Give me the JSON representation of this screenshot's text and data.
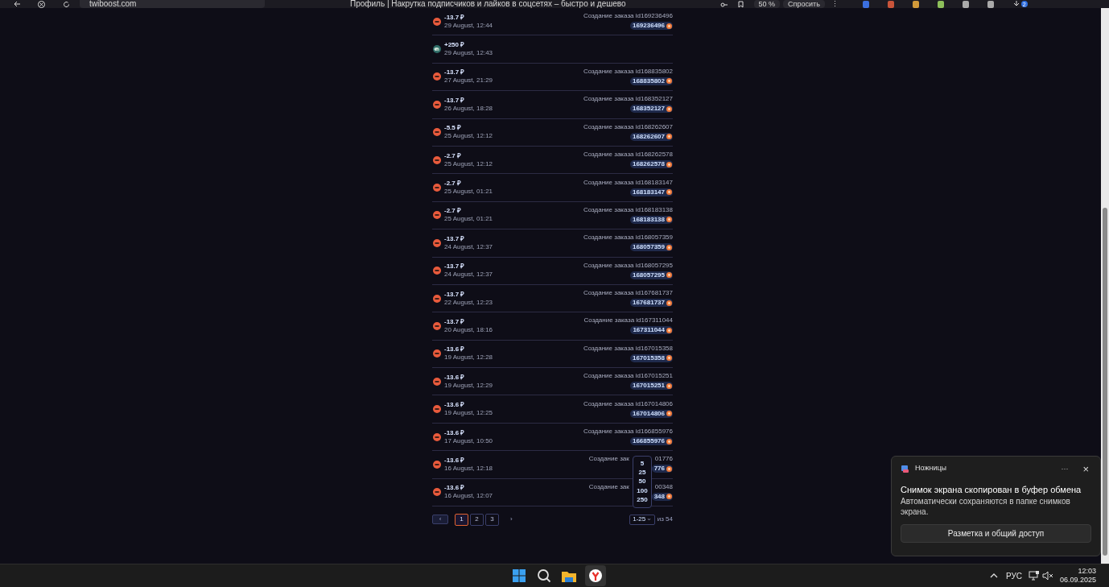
{
  "browser": {
    "url": "twiboost.com",
    "title": "Профиль | Накрутка подписчиков и лайков в соцсетях – быстро и дешево",
    "zoom": "50 %",
    "ask_label": "Спросить",
    "menu": "⋮",
    "notifications": "2"
  },
  "transactions": [
    {
      "kind": "debit",
      "amount": "-13.7 ₽",
      "date": "29 August, 12:44",
      "description": [
        "Создание заказа id169236496"
      ],
      "badge": "169236496"
    },
    {
      "kind": "credit",
      "amount": "+250 ₽",
      "date": "29 August, 12:43"
    },
    {
      "kind": "debit",
      "amount": "-13.7 ₽",
      "date": "27 August, 21:29",
      "description": [
        "Создание заказа id168835802"
      ],
      "badge": "168835802"
    },
    {
      "kind": "debit",
      "amount": "-13.7 ₽",
      "date": "26 August, 18:28",
      "description": [
        "Создание заказа id168352127"
      ],
      "badge": "168352127"
    },
    {
      "kind": "debit",
      "amount": "-5.5 ₽",
      "date": "25 August, 12:12",
      "description": [
        "Создание заказа id168262607"
      ],
      "badge": "168262607"
    },
    {
      "kind": "debit",
      "amount": "-2.7 ₽",
      "date": "25 August, 12:12",
      "description": [
        "Создание заказа id168262578"
      ],
      "badge": "168262578"
    },
    {
      "kind": "debit",
      "amount": "-2.7 ₽",
      "date": "25 August, 01:21",
      "description": [
        "Создание заказа id168183147"
      ],
      "badge": "168183147"
    },
    {
      "kind": "debit",
      "amount": "-2.7 ₽",
      "date": "25 August, 01:21",
      "description": [
        "Создание заказа id168183138"
      ],
      "badge": "168183138"
    },
    {
      "kind": "debit",
      "amount": "-13.7 ₽",
      "date": "24 August, 12:37",
      "description": [
        "Создание заказа id168057359"
      ],
      "badge": "168057359"
    },
    {
      "kind": "debit",
      "amount": "-13.7 ₽",
      "date": "24 August, 12:37",
      "description": [
        "Создание заказа id168057295"
      ],
      "badge": "168057295"
    },
    {
      "kind": "debit",
      "amount": "-13.7 ₽",
      "date": "22 August, 12:23",
      "description": [
        "Создание заказа id167681737"
      ],
      "badge": "167681737"
    },
    {
      "kind": "debit",
      "amount": "-13.7 ₽",
      "date": "20 August, 18:16",
      "description": [
        "Создание заказа id167311044"
      ],
      "badge": "167311044"
    },
    {
      "kind": "debit",
      "amount": "-13.6 ₽",
      "date": "19 August, 12:28",
      "description": [
        "Создание заказа id167015358"
      ],
      "badge": "167015358"
    },
    {
      "kind": "debit",
      "amount": "-13.6 ₽",
      "date": "19 August, 12:29",
      "description": [
        "Создание заказа id167015251"
      ],
      "badge": "167015251"
    },
    {
      "kind": "debit",
      "amount": "-13.6 ₽",
      "date": "19 August, 12:25",
      "description": [
        "Создание заказа id167014806"
      ],
      "badge": "167014806"
    },
    {
      "kind": "debit",
      "amount": "-13.6 ₽",
      "date": "17 August, 10:50",
      "description": [
        "Создание заказа id166855976"
      ],
      "badge": "166855976"
    },
    {
      "kind": "debit",
      "amount": "-13.6 ₽",
      "date": "16 August, 12:18",
      "description": [
        "Создание зак",
        "01776"
      ],
      "badge": "776"
    },
    {
      "kind": "debit",
      "amount": "-13.6 ₽",
      "date": "16 August, 12:07",
      "description": [
        "Создание зак",
        "00348"
      ],
      "badge": "348"
    }
  ],
  "pagination": {
    "prev": "‹",
    "next": "›",
    "pages": [
      {
        "label": "1",
        "selected": true
      },
      {
        "label": "2",
        "selected": false
      },
      {
        "label": "3",
        "selected": false
      }
    ],
    "per_page": "1-25",
    "total": "из 54",
    "options": [
      "5",
      "25",
      "50",
      "100",
      "250"
    ]
  },
  "notification": {
    "app": "Ножницы",
    "more": "···",
    "close": "×",
    "title": "Снимок экрана скопирован в буфер обмена",
    "body": "Автоматически сохраняются в папке снимков экрана.",
    "action": "Разметка и общий доступ"
  },
  "taskbar": {
    "language": "РУС",
    "time": "12:03",
    "date": "06.09.2025"
  }
}
